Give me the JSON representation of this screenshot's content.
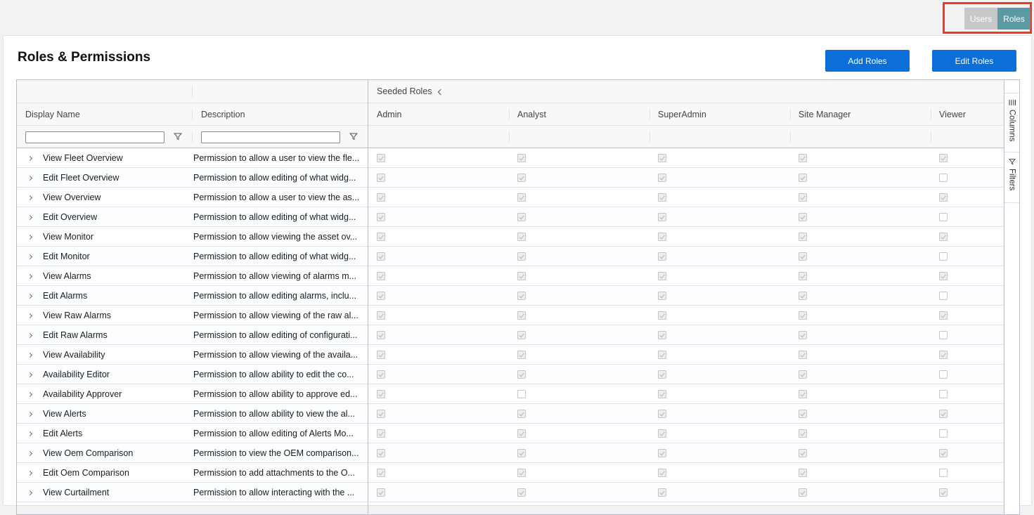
{
  "toggle": {
    "users_label": "Users",
    "roles_label": "Roles"
  },
  "page": {
    "title": "Roles & Permissions"
  },
  "actions": {
    "add_label": "Add Roles",
    "edit_label": "Edit Roles"
  },
  "grid": {
    "group_header": "Seeded Roles",
    "columns": {
      "display_name": "Display Name",
      "description": "Description",
      "admin": "Admin",
      "analyst": "Analyst",
      "superadmin": "SuperAdmin",
      "site_manager": "Site Manager",
      "viewer": "Viewer"
    },
    "filters": {
      "display_name": "",
      "description": ""
    },
    "rows": [
      {
        "name": "View Fleet Overview",
        "description": "Permission to allow a user to view the fle...",
        "roles": [
          true,
          true,
          true,
          true,
          true
        ]
      },
      {
        "name": "Edit Fleet Overview",
        "description": "Permission to allow editing of what widg...",
        "roles": [
          true,
          true,
          true,
          true,
          false
        ]
      },
      {
        "name": "View Overview",
        "description": "Permission to allow a user to view the as...",
        "roles": [
          true,
          true,
          true,
          true,
          true
        ]
      },
      {
        "name": "Edit Overview",
        "description": "Permission to allow editing of what widg...",
        "roles": [
          true,
          true,
          true,
          true,
          false
        ]
      },
      {
        "name": "View Monitor",
        "description": "Permission to allow viewing the asset ov...",
        "roles": [
          true,
          true,
          true,
          true,
          true
        ]
      },
      {
        "name": "Edit Monitor",
        "description": "Permission to allow editing of what widg...",
        "roles": [
          true,
          true,
          true,
          true,
          false
        ]
      },
      {
        "name": "View Alarms",
        "description": "Permission to allow viewing of alarms m...",
        "roles": [
          true,
          true,
          true,
          true,
          true
        ]
      },
      {
        "name": "Edit Alarms",
        "description": "Permission to allow editing alarms, inclu...",
        "roles": [
          true,
          true,
          true,
          true,
          false
        ]
      },
      {
        "name": "View Raw Alarms",
        "description": "Permission to allow viewing of the raw al...",
        "roles": [
          true,
          true,
          true,
          true,
          true
        ]
      },
      {
        "name": "Edit Raw Alarms",
        "description": "Permission to allow editing of configurati...",
        "roles": [
          true,
          true,
          true,
          true,
          false
        ]
      },
      {
        "name": "View Availability",
        "description": "Permission to allow viewing of the availa...",
        "roles": [
          true,
          true,
          true,
          true,
          true
        ]
      },
      {
        "name": "Availability Editor",
        "description": "Permission to allow ability to edit the co...",
        "roles": [
          true,
          true,
          true,
          true,
          false
        ]
      },
      {
        "name": "Availability Approver",
        "description": "Permission to allow ability to approve ed...",
        "roles": [
          true,
          false,
          true,
          true,
          false
        ]
      },
      {
        "name": "View Alerts",
        "description": "Permission to allow ability to view the al...",
        "roles": [
          true,
          true,
          true,
          true,
          true
        ]
      },
      {
        "name": "Edit Alerts",
        "description": "Permission to allow editing of Alerts Mo...",
        "roles": [
          true,
          true,
          true,
          true,
          false
        ]
      },
      {
        "name": "View Oem Comparison",
        "description": "Permission to view the OEM comparison...",
        "roles": [
          true,
          true,
          true,
          true,
          true
        ]
      },
      {
        "name": "Edit Oem Comparison",
        "description": "Permission to add attachments to the O...",
        "roles": [
          true,
          true,
          true,
          true,
          false
        ]
      },
      {
        "name": "View Curtailment",
        "description": "Permission to allow interacting with the ...",
        "roles": [
          true,
          true,
          true,
          true,
          true
        ]
      }
    ]
  },
  "sidebar": {
    "columns_label": "Columns",
    "filters_label": "Filters"
  }
}
